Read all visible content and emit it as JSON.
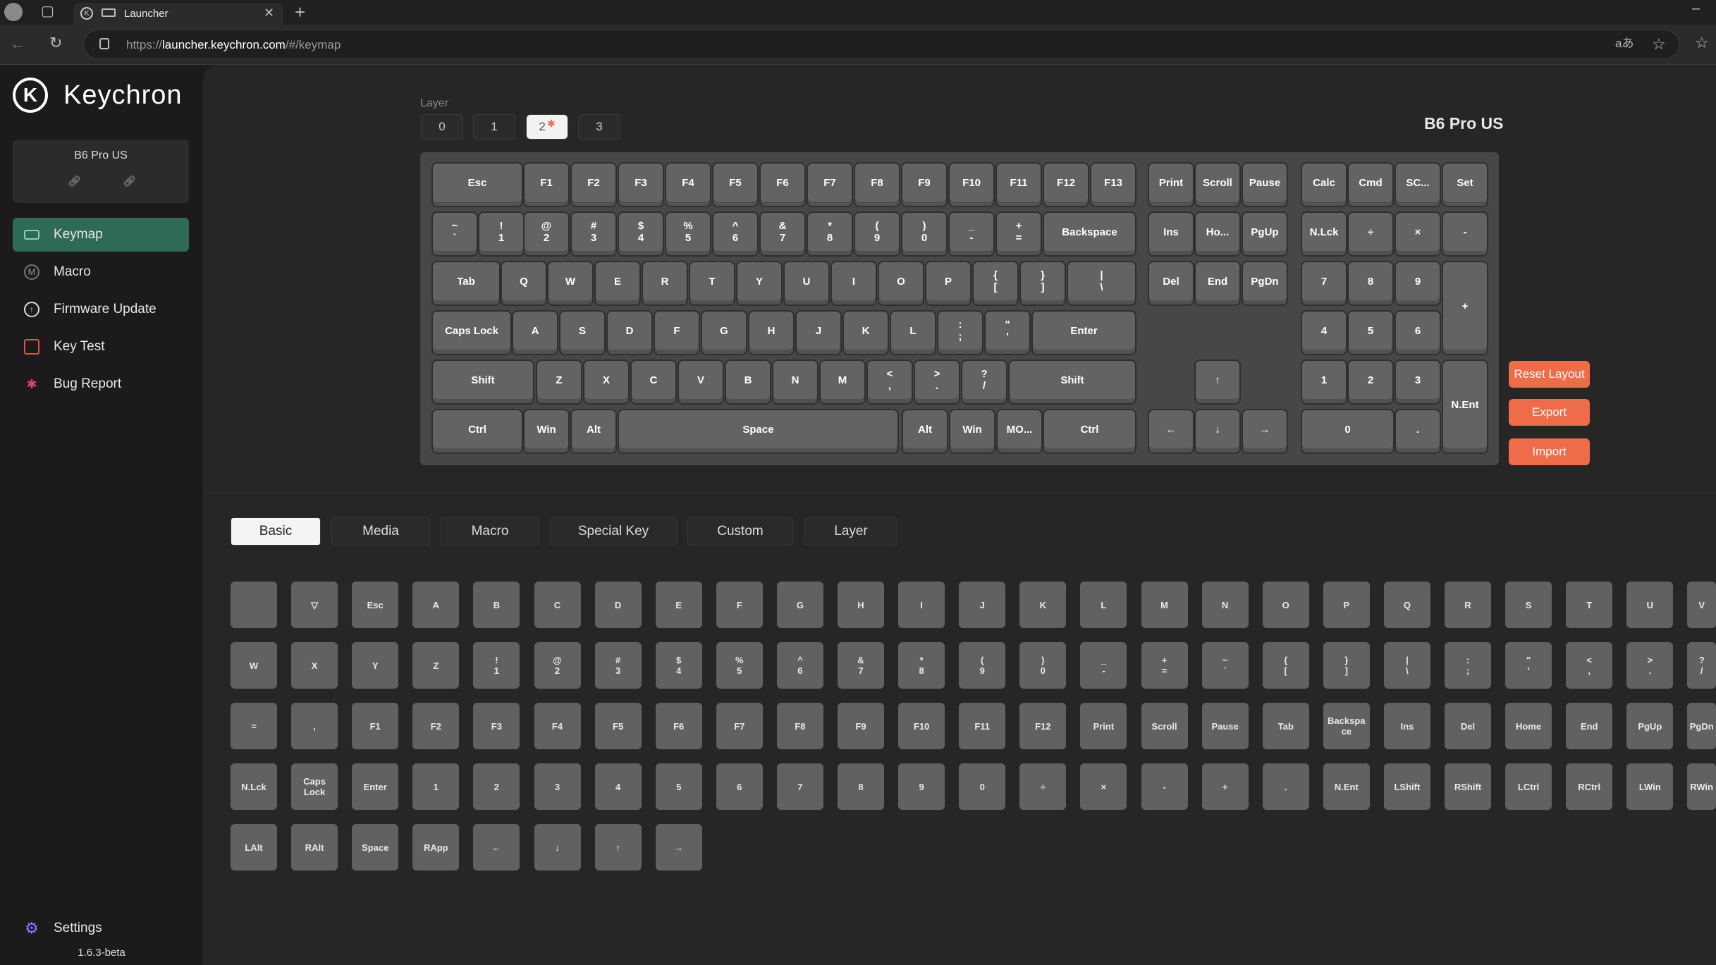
{
  "browser": {
    "tab_title": "Launcher",
    "url_prefix": "https://",
    "url_host": "launcher.keychron.com",
    "url_path": "/#/keymap"
  },
  "sidebar": {
    "brand": "Keychron",
    "device_name": "B6 Pro US",
    "items": [
      {
        "label": "Keymap",
        "icon": "keyboard-icon",
        "active": true
      },
      {
        "label": "Macro",
        "icon": "macro-icon"
      },
      {
        "label": "Firmware Update",
        "icon": "firmware-icon"
      },
      {
        "label": "Key Test",
        "icon": "key-test-icon"
      },
      {
        "label": "Bug Report",
        "icon": "bug-icon"
      }
    ],
    "settings_label": "Settings",
    "version": "1.6.3-beta"
  },
  "layers": {
    "label": "Layer",
    "items": [
      "0",
      "1",
      "2",
      "3"
    ],
    "selected": "2"
  },
  "device_title": "B6 Pro US",
  "actions": {
    "reset": "Reset Layout",
    "export": "Export",
    "import": "Import"
  },
  "keyboard": {
    "rows": [
      [
        [
          "Esc"
        ],
        [
          "F1"
        ],
        [
          "F2"
        ],
        [
          "F3"
        ],
        [
          "F4"
        ],
        [
          "F5"
        ],
        [
          "F6"
        ],
        [
          "F7"
        ],
        [
          "F8"
        ],
        [
          "F9"
        ],
        [
          "F10"
        ],
        [
          "F11"
        ],
        [
          "F12"
        ],
        [
          "F13"
        ],
        [
          "Print"
        ],
        [
          "Scroll"
        ],
        [
          "Pause"
        ],
        [
          "Calc"
        ],
        [
          "Cmd"
        ],
        [
          "SC..."
        ],
        [
          "Set"
        ]
      ],
      [
        [
          "~",
          "`"
        ],
        [
          "!",
          "1"
        ],
        [
          "@",
          "2"
        ],
        [
          "#",
          "3"
        ],
        [
          "$",
          "4"
        ],
        [
          "%",
          "5"
        ],
        [
          "^",
          "6"
        ],
        [
          "&",
          "7"
        ],
        [
          "*",
          "8"
        ],
        [
          "(",
          "9"
        ],
        [
          ")",
          "0"
        ],
        [
          "_",
          "-"
        ],
        [
          "+",
          "="
        ],
        [
          "Backspace"
        ],
        [
          "Ins"
        ],
        [
          "Ho..."
        ],
        [
          "PgUp"
        ],
        [
          "N.Lck"
        ],
        [
          "÷"
        ],
        [
          "×"
        ],
        [
          "-"
        ]
      ],
      [
        [
          "Tab"
        ],
        [
          "Q"
        ],
        [
          "W"
        ],
        [
          "E"
        ],
        [
          "R"
        ],
        [
          "T"
        ],
        [
          "Y"
        ],
        [
          "U"
        ],
        [
          "I"
        ],
        [
          "O"
        ],
        [
          "P"
        ],
        [
          "{",
          "["
        ],
        [
          "}",
          "]"
        ],
        [
          "|",
          "\\"
        ],
        [
          "Del"
        ],
        [
          "End"
        ],
        [
          "PgDn"
        ],
        [
          "7"
        ],
        [
          "8"
        ],
        [
          "9"
        ],
        [
          "+"
        ]
      ],
      [
        [
          "Caps Lock"
        ],
        [
          "A"
        ],
        [
          "S"
        ],
        [
          "D"
        ],
        [
          "F"
        ],
        [
          "G"
        ],
        [
          "H"
        ],
        [
          "J"
        ],
        [
          "K"
        ],
        [
          "L"
        ],
        [
          ":",
          ";"
        ],
        [
          "\"",
          "'"
        ],
        [
          "Enter"
        ],
        [
          "4"
        ],
        [
          "5"
        ],
        [
          "6"
        ]
      ],
      [
        [
          "Shift"
        ],
        [
          "Z"
        ],
        [
          "X"
        ],
        [
          "C"
        ],
        [
          "V"
        ],
        [
          "B"
        ],
        [
          "N"
        ],
        [
          "M"
        ],
        [
          "<",
          ","
        ],
        [
          ">",
          "."
        ],
        [
          "?",
          "/"
        ],
        [
          "Shift"
        ],
        [
          "↑"
        ],
        [
          "1"
        ],
        [
          "2"
        ],
        [
          "3"
        ],
        [
          "N.Ent"
        ]
      ],
      [
        [
          "Ctrl"
        ],
        [
          "Win"
        ],
        [
          "Alt"
        ],
        [
          "Space"
        ],
        [
          "Alt"
        ],
        [
          "Win"
        ],
        [
          "MO..."
        ],
        [
          "Ctrl"
        ],
        [
          "←"
        ],
        [
          "↓"
        ],
        [
          "→"
        ],
        [
          "0"
        ],
        [
          "."
        ]
      ]
    ]
  },
  "category_tabs": [
    "Basic",
    "Media",
    "Macro",
    "Special Key",
    "Custom",
    "Layer"
  ],
  "selected_category": "Basic",
  "palette_rows": [
    [
      [
        ""
      ],
      [
        "▽"
      ],
      [
        "Esc"
      ],
      [
        "A"
      ],
      [
        "B"
      ],
      [
        "C"
      ],
      [
        "D"
      ],
      [
        "E"
      ],
      [
        "F"
      ],
      [
        "G"
      ],
      [
        "H"
      ],
      [
        "I"
      ],
      [
        "J"
      ],
      [
        "K"
      ],
      [
        "L"
      ],
      [
        "M"
      ],
      [
        "N"
      ],
      [
        "O"
      ],
      [
        "P"
      ],
      [
        "Q"
      ],
      [
        "R"
      ],
      [
        "S"
      ],
      [
        "T"
      ],
      [
        "U"
      ],
      [
        "V"
      ]
    ],
    [
      [
        "W"
      ],
      [
        "X"
      ],
      [
        "Y"
      ],
      [
        "Z"
      ],
      [
        "!",
        "1"
      ],
      [
        "@",
        "2"
      ],
      [
        "#",
        "3"
      ],
      [
        "$",
        "4"
      ],
      [
        "%",
        "5"
      ],
      [
        "^",
        "6"
      ],
      [
        "&",
        "7"
      ],
      [
        "*",
        "8"
      ],
      [
        "(",
        "9"
      ],
      [
        ")",
        "0"
      ],
      [
        "_",
        "-"
      ],
      [
        "+",
        "="
      ],
      [
        "~",
        "`"
      ],
      [
        "{",
        "["
      ],
      [
        "}",
        "]"
      ],
      [
        "|",
        "\\"
      ],
      [
        ":",
        ";"
      ],
      [
        "\"",
        "'"
      ],
      [
        "<",
        ","
      ],
      [
        ">",
        "."
      ],
      [
        "?",
        "/"
      ]
    ],
    [
      [
        "="
      ],
      [
        ","
      ],
      [
        "F1"
      ],
      [
        "F2"
      ],
      [
        "F3"
      ],
      [
        "F4"
      ],
      [
        "F5"
      ],
      [
        "F6"
      ],
      [
        "F7"
      ],
      [
        "F8"
      ],
      [
        "F9"
      ],
      [
        "F10"
      ],
      [
        "F11"
      ],
      [
        "F12"
      ],
      [
        "Print"
      ],
      [
        "Scroll"
      ],
      [
        "Pause"
      ],
      [
        "Tab"
      ],
      [
        "Backspa",
        "ce"
      ],
      [
        "Ins"
      ],
      [
        "Del"
      ],
      [
        "Home"
      ],
      [
        "End"
      ],
      [
        "PgUp"
      ],
      [
        "PgDn"
      ]
    ],
    [
      [
        "N.Lck"
      ],
      [
        "Caps",
        "Lock"
      ],
      [
        "Enter"
      ],
      [
        "1"
      ],
      [
        "2"
      ],
      [
        "3"
      ],
      [
        "4"
      ],
      [
        "5"
      ],
      [
        "6"
      ],
      [
        "7"
      ],
      [
        "8"
      ],
      [
        "9"
      ],
      [
        "0"
      ],
      [
        "÷"
      ],
      [
        "×"
      ],
      [
        "-"
      ],
      [
        "+"
      ],
      [
        "."
      ],
      [
        "N.Ent"
      ],
      [
        "LShift"
      ],
      [
        "RShift"
      ],
      [
        "LCtrl"
      ],
      [
        "RCtrl"
      ],
      [
        "LWin"
      ],
      [
        "RWin"
      ]
    ],
    [
      [
        "LAlt"
      ],
      [
        "RAlt"
      ],
      [
        "Space"
      ],
      [
        "RApp"
      ],
      [
        "←"
      ],
      [
        "↓"
      ],
      [
        "↑"
      ],
      [
        "→"
      ]
    ]
  ],
  "colors": {
    "accent": "#ef6c48",
    "active_nav": "#2e6a55"
  }
}
